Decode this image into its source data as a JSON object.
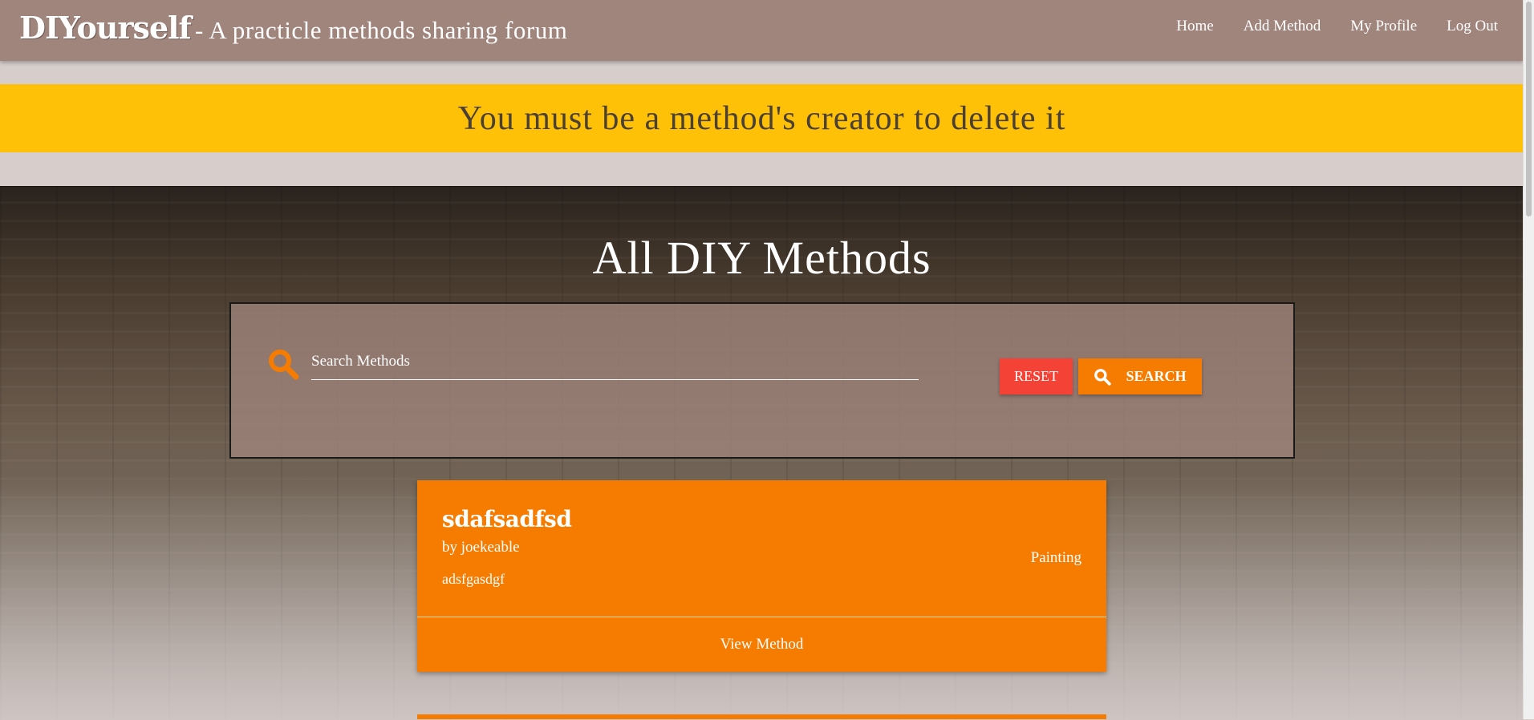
{
  "navbar": {
    "brand": "DIYourself",
    "tagline": "- A practicle methods sharing forum",
    "links": [
      {
        "label": "Home"
      },
      {
        "label": "Add Method"
      },
      {
        "label": "My Profile"
      },
      {
        "label": "Log Out"
      }
    ]
  },
  "alert": {
    "message": "You must be a method's creator to delete it"
  },
  "main": {
    "title": "All DIY Methods",
    "search": {
      "placeholder": "Search Methods",
      "value": "",
      "reset_label": "RESET",
      "search_label": "SEARCH"
    },
    "methods": [
      {
        "title": "sdafsadfsd",
        "author": "by joekeable",
        "description": "adsfgasdgf",
        "category": "Painting",
        "action_label": "View Method"
      }
    ]
  },
  "colors": {
    "navbar": "#a0857d",
    "alert": "#fec107",
    "accent": "#f57c00",
    "reset": "#f44336"
  }
}
